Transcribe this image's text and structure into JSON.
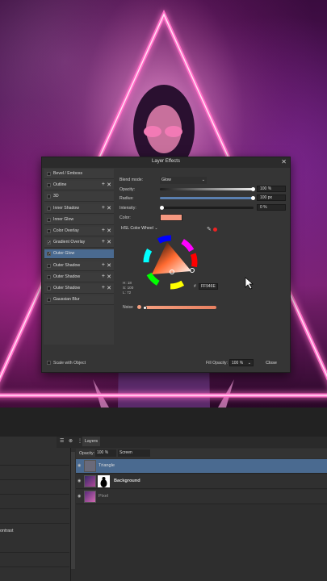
{
  "dialog": {
    "title": "Layer Effects",
    "close_glyph": "✕",
    "effects": [
      {
        "label": "Bevel / Emboss",
        "checked": false,
        "has_add": false
      },
      {
        "label": "Outline",
        "checked": false,
        "has_add": true
      },
      {
        "label": "3D",
        "checked": false,
        "has_add": false
      },
      {
        "label": "Inner Shadow",
        "checked": false,
        "has_add": true
      },
      {
        "label": "Inner Glow",
        "checked": false,
        "has_add": false
      },
      {
        "label": "Color Overlay",
        "checked": false,
        "has_add": true
      },
      {
        "label": "Gradient Overlay",
        "checked": true,
        "has_add": true
      },
      {
        "label": "Outer Glow",
        "checked": true,
        "has_add": false,
        "selected": true
      },
      {
        "label": "Outer Shadow",
        "checked": false,
        "has_add": true
      },
      {
        "label": "Outer Shadow",
        "checked": false,
        "has_add": true
      },
      {
        "label": "Outer Shadow",
        "checked": false,
        "has_add": true
      },
      {
        "label": "Gaussian Blur",
        "checked": false,
        "has_add": false
      }
    ],
    "plus_glyph": "+",
    "x_glyph": "✕",
    "check_glyph": "✓",
    "blend_mode_label": "Blend mode:",
    "blend_mode_value": "Glow",
    "opacity_label": "Opacity:",
    "opacity_value": "100 %",
    "opacity_level": 1.0,
    "radius_label": "Radius:",
    "radius_value": "100 px",
    "radius_level": 1.0,
    "intensity_label": "Intensity:",
    "intensity_value": "0 %",
    "intensity_level": 0.0,
    "color_label": "Color:",
    "color_swatch": "#f59880",
    "wheel_mode": "HSL Color Wheel",
    "hsl": {
      "h": "H: 18",
      "s": "S: 100",
      "l": "L: 72"
    },
    "hex_hash": "#",
    "hex_value": "FF946E",
    "noise_label": "Noise",
    "scale_label": "Scale with Object",
    "fill_opacity_label": "Fill Opacity:",
    "fill_opacity_value": "100 %",
    "close_label": "Close"
  },
  "layers_panel": {
    "tab_label": "Layers",
    "opacity_label": "Opacity:",
    "opacity_value": "100 %",
    "blend_value": "Screen",
    "layers": [
      {
        "name": "Triangle",
        "selected": true
      },
      {
        "name": "Background",
        "selected": false
      },
      {
        "name": "Pixel",
        "selected": false
      }
    ]
  },
  "left_panel": {
    "partial_label": "ontrast"
  },
  "colors": {
    "neon": "#ff6ec7",
    "accent": "#4a6a90"
  },
  "icons": [
    "close-icon",
    "eyedropper-icon",
    "menu-icon",
    "visibility-icon",
    "dropdown-caret-icon",
    "cursor-arrow-icon"
  ]
}
